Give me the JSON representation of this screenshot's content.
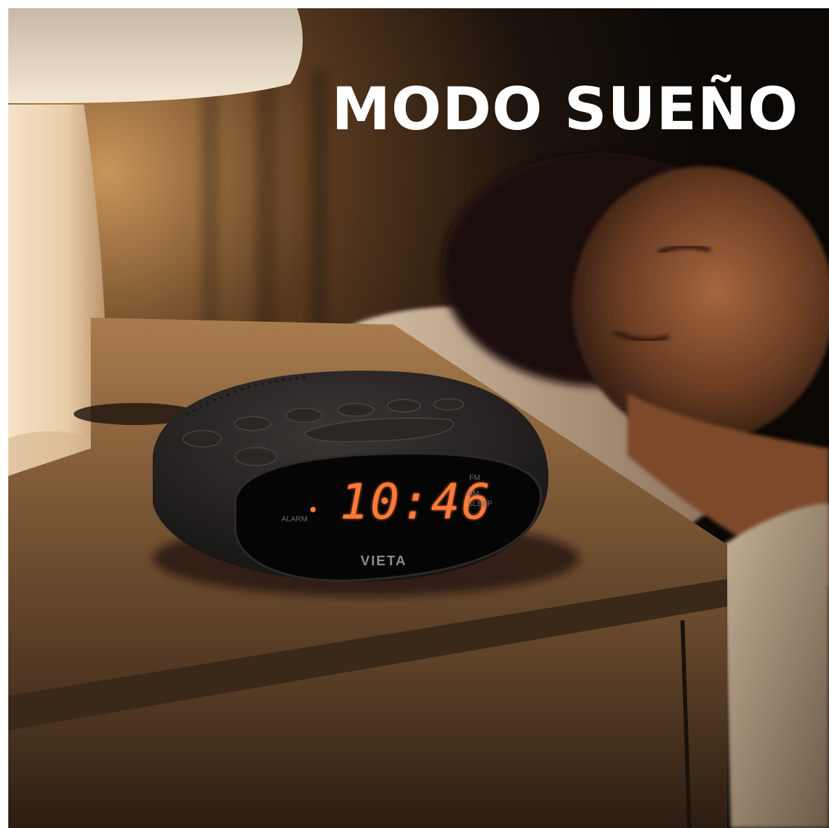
{
  "headline": "MODO SUEÑO",
  "clock": {
    "time": "10:46",
    "alarm_label": "ALARM",
    "fm_label": "FM",
    "am_label": "AM",
    "sleep_label": "SLEEP",
    "brand": "VIETA"
  },
  "colors": {
    "display_digits": "#ff7a3a",
    "headline": "#ffffff",
    "background": "#0b0806"
  }
}
